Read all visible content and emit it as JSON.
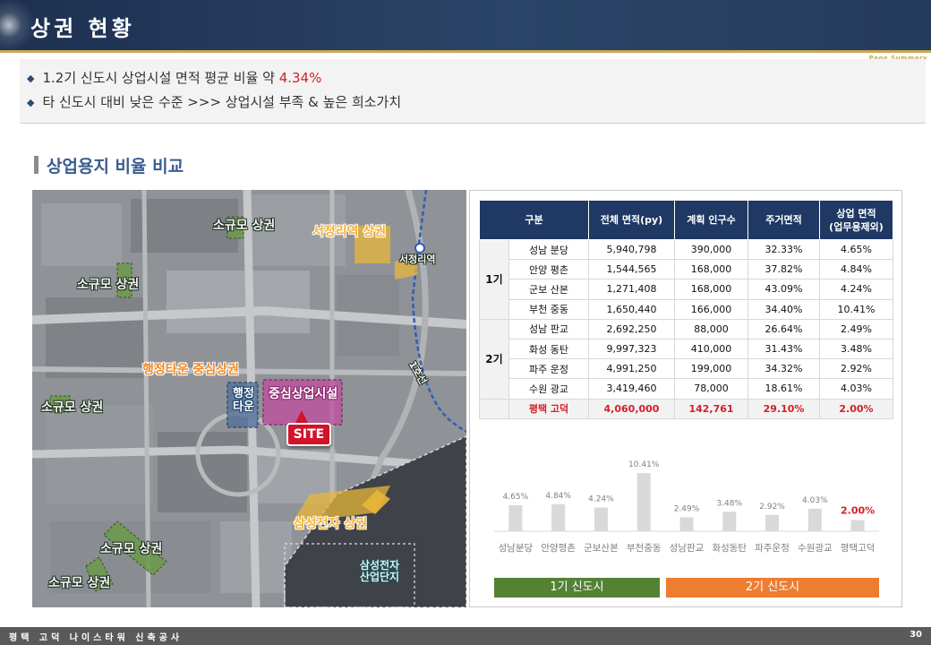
{
  "header": {
    "title": "상권 현황",
    "page_summary": "Page Summary"
  },
  "summary": {
    "line1_prefix": "1.2기 신도시 상업시설 면적 평균 비율 약 ",
    "line1_highlight": "4.34%",
    "line2": "타 신도시 대비 낮은 수준 >>> 상업시설 부족 & 높은 희소가치"
  },
  "section_title": "상업용지 비율 비교",
  "map": {
    "labels": {
      "small1": "소규모 상권",
      "small2": "소규모 상권",
      "small3": "소규모 상권",
      "small4": "소규모 상권",
      "small5": "소규모 상권",
      "seojeong": "서정리역 상권",
      "seojeong_station": "서정리역",
      "haengjeong": "행정타운 중심상권",
      "haengjeong_box_1": "행정",
      "haengjeong_box_2": "타운",
      "central": "중심상업시설",
      "samsung": "삼성전자 상권",
      "samsung_complex_1": "삼성전자",
      "samsung_complex_2": "산업단지",
      "line1": "1호선",
      "site": "SITE"
    }
  },
  "table": {
    "headers": [
      "구분",
      "전체 면적(py)",
      "계획 인구수",
      "주거면적",
      "상업 면적",
      "(업무용제외)"
    ],
    "groups": [
      {
        "name": "1기",
        "rows": [
          [
            "성남 분당",
            "5,940,798",
            "390,000",
            "32.33%",
            "4.65%"
          ],
          [
            "안양 평촌",
            "1,544,565",
            "168,000",
            "37.82%",
            "4.84%"
          ],
          [
            "군보 산본",
            "1,271,408",
            "168,000",
            "43.09%",
            "4.24%"
          ],
          [
            "부천 중동",
            "1,650,440",
            "166,000",
            "34.40%",
            "10.41%"
          ]
        ]
      },
      {
        "name": "2기",
        "rows": [
          [
            "성남 판교",
            "2,692,250",
            "88,000",
            "26.64%",
            "2.49%"
          ],
          [
            "화성 동탄",
            "9,997,323",
            "410,000",
            "31.43%",
            "3.48%"
          ],
          [
            "파주 운정",
            "4,991,250",
            "199,000",
            "34.32%",
            "2.92%"
          ],
          [
            "수원 광교",
            "3,419,460",
            "78,000",
            "18.61%",
            "4.03%"
          ]
        ]
      }
    ],
    "highlight_row": [
      "평택 고덕",
      "4,060,000",
      "142,761",
      "29.10%",
      "2.00%"
    ]
  },
  "chart_data": {
    "type": "bar",
    "categories": [
      "성남분당",
      "안양평촌",
      "군보산본",
      "부천중동",
      "성남판교",
      "화성동탄",
      "파주운정",
      "수원광교",
      "평택고덕"
    ],
    "values": [
      4.65,
      4.84,
      4.24,
      10.41,
      2.49,
      3.48,
      2.92,
      4.03,
      2.0
    ],
    "data_labels": [
      "4.65%",
      "4.84%",
      "4.24%",
      "10.41%",
      "2.49%",
      "3.48%",
      "2.92%",
      "4.03%",
      "2.00%"
    ],
    "ylim": [
      0,
      10.41
    ],
    "bar_color": "#d9d9d9",
    "highlight_color": "#d1212a",
    "groups": [
      {
        "name": "1기 신도시",
        "color": "#548235"
      },
      {
        "name": "2기 신도시",
        "color": "#ed7d31"
      }
    ]
  },
  "footer": {
    "text": "평택 고덕 나이스타워 신축공사",
    "page": "30"
  },
  "colors": {
    "header": "#1d3050",
    "accent_gold": "#c9a955",
    "red": "#d1212a",
    "section": "#3a5c8f"
  }
}
